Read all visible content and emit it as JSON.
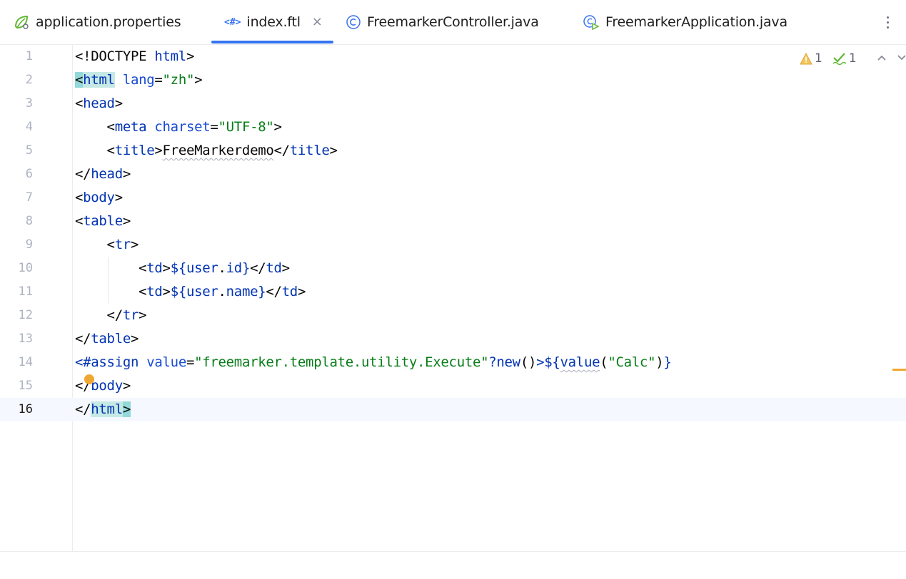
{
  "tabs": [
    {
      "label": "application.properties",
      "icon": "spring-leaf-icon",
      "active": false
    },
    {
      "label": "index.ftl",
      "icon": "freemarker-file-icon",
      "icon_text": "<#>",
      "active": true,
      "closable": true
    },
    {
      "label": "FreemarkerController.java",
      "icon": "java-class-icon",
      "active": false
    },
    {
      "label": "FreemarkerApplication.java",
      "icon": "spring-boot-app-icon",
      "active": false
    }
  ],
  "close_glyph": "×",
  "inspections": {
    "warnings": "1",
    "weak_warnings": "1"
  },
  "editor": {
    "current_line": 16,
    "lines": [
      {
        "n": "1",
        "tokens": [
          [
            "plain",
            "<!DOCTYPE "
          ],
          [
            "tag",
            "html"
          ],
          [
            "plain",
            ">"
          ]
        ]
      },
      {
        "n": "2",
        "tokens": [
          [
            "plain",
            "<"
          ],
          [
            "tag",
            "html"
          ],
          [
            "plain",
            " "
          ],
          [
            "attr",
            "lang"
          ],
          [
            "plain",
            "="
          ],
          [
            "str",
            "\"zh\""
          ],
          [
            "plain",
            ">"
          ]
        ]
      },
      {
        "n": "3",
        "tokens": [
          [
            "plain",
            "<"
          ],
          [
            "tag",
            "head"
          ],
          [
            "plain",
            ">"
          ]
        ]
      },
      {
        "n": "4",
        "tokens": [
          [
            "plain",
            "    <"
          ],
          [
            "tag",
            "meta"
          ],
          [
            "plain",
            " "
          ],
          [
            "attr",
            "charset"
          ],
          [
            "plain",
            "="
          ],
          [
            "str",
            "\"UTF-8\""
          ],
          [
            "plain",
            ">"
          ]
        ]
      },
      {
        "n": "5",
        "tokens": [
          [
            "plain",
            "    <"
          ],
          [
            "tag",
            "title"
          ],
          [
            "plain",
            ">"
          ],
          [
            "plain",
            "FreeMarkerdemo"
          ],
          [
            "plain",
            "</"
          ],
          [
            "tag",
            "title"
          ],
          [
            "plain",
            ">"
          ]
        ]
      },
      {
        "n": "6",
        "tokens": [
          [
            "plain",
            "</"
          ],
          [
            "tag",
            "head"
          ],
          [
            "plain",
            ">"
          ]
        ]
      },
      {
        "n": "7",
        "tokens": [
          [
            "plain",
            "<"
          ],
          [
            "tag",
            "body"
          ],
          [
            "plain",
            ">"
          ]
        ]
      },
      {
        "n": "8",
        "tokens": [
          [
            "plain",
            "<"
          ],
          [
            "tag",
            "table"
          ],
          [
            "plain",
            ">"
          ]
        ]
      },
      {
        "n": "9",
        "tokens": [
          [
            "plain",
            "    <"
          ],
          [
            "tag",
            "tr"
          ],
          [
            "plain",
            ">"
          ]
        ]
      },
      {
        "n": "10",
        "tokens": [
          [
            "plain",
            "        <"
          ],
          [
            "tag",
            "td"
          ],
          [
            "plain",
            ">"
          ],
          [
            "ftl",
            "${user"
          ],
          [
            "plain",
            "."
          ],
          [
            "ftl",
            "id}"
          ],
          [
            "plain",
            "</"
          ],
          [
            "tag",
            "td"
          ],
          [
            "plain",
            ">"
          ]
        ]
      },
      {
        "n": "11",
        "tokens": [
          [
            "plain",
            "        <"
          ],
          [
            "tag",
            "td"
          ],
          [
            "plain",
            ">"
          ],
          [
            "ftl",
            "${user"
          ],
          [
            "plain",
            "."
          ],
          [
            "ftl",
            "name}"
          ],
          [
            "plain",
            "</"
          ],
          [
            "tag",
            "td"
          ],
          [
            "plain",
            ">"
          ]
        ]
      },
      {
        "n": "12",
        "tokens": [
          [
            "plain",
            "    </"
          ],
          [
            "tag",
            "tr"
          ],
          [
            "plain",
            ">"
          ]
        ]
      },
      {
        "n": "13",
        "tokens": [
          [
            "plain",
            "</"
          ],
          [
            "tag",
            "table"
          ],
          [
            "plain",
            ">"
          ]
        ]
      },
      {
        "n": "14",
        "tokens": [
          [
            "ftl",
            "<#assign"
          ],
          [
            "plain",
            " "
          ],
          [
            "attr",
            "value"
          ],
          [
            "plain",
            "="
          ],
          [
            "str",
            "\"freemarker.template.utility.Execute\""
          ],
          [
            "ftl",
            "?new"
          ],
          [
            "plain",
            "()"
          ],
          [
            "ftl",
            ">${"
          ],
          [
            "ftl",
            "value"
          ],
          [
            "plain",
            "("
          ],
          [
            "str",
            "\"Calc\""
          ],
          [
            "plain",
            ")"
          ],
          [
            "ftl",
            "}"
          ]
        ]
      },
      {
        "n": "15",
        "tokens": [
          [
            "plain",
            "</"
          ],
          [
            "tag",
            "body"
          ],
          [
            "plain",
            ">"
          ]
        ]
      },
      {
        "n": "16",
        "tokens": [
          [
            "plain",
            "</"
          ],
          [
            "tag",
            "html"
          ],
          [
            "plain",
            ">"
          ]
        ]
      }
    ]
  }
}
